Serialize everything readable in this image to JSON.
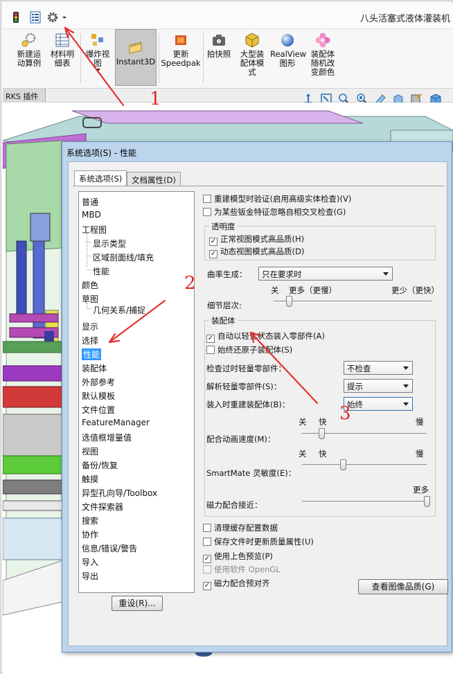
{
  "app": {
    "title": "八头活塞式液体灌装机"
  },
  "ribbon": {
    "buttons": [
      {
        "id": "new-motion",
        "label": "新建运\n动算例"
      },
      {
        "id": "bom",
        "label": "材料明\n细表"
      },
      {
        "id": "exploded",
        "label": "爆炸视\n图"
      },
      {
        "id": "instant3d",
        "label": "Instant3D"
      },
      {
        "id": "speedpak",
        "label": "更新\nSpeedpak"
      },
      {
        "id": "snapshot",
        "label": "拍快照"
      },
      {
        "id": "large-assembly",
        "label": "大型装\n配体模\n式"
      },
      {
        "id": "realview",
        "label": "RealView\n图形"
      },
      {
        "id": "random-color",
        "label": "装配体\n随机改\n变颜色"
      }
    ]
  },
  "tabbar": {
    "plugin_tab": "RKS 插件"
  },
  "dialog": {
    "title": "系统选项(S) - 性能",
    "tabs": [
      "系统选项(S)",
      "文档属性(D)"
    ],
    "nav": [
      "普通",
      "MBD",
      "工程图",
      "显示类型",
      "区域剖面线/填充",
      "性能",
      "颜色",
      "草图",
      "几何关系/捕捉",
      "显示",
      "选择",
      "性能",
      "装配体",
      "外部参考",
      "默认模板",
      "文件位置",
      "FeatureManager",
      "选值框增量值",
      "视图",
      "备份/恢复",
      "触摸",
      "异型孔向导/Toolbox",
      "文件探索器",
      "搜索",
      "协作",
      "信息/错误/警告",
      "导入",
      "导出"
    ],
    "reset_button": "重设(R)...",
    "options": {
      "rebuild_verify": "重建模型时验证(启用高级实体检查)(V)",
      "ignore_sheetmetal": "为某些钣金特征忽略自相交叉检查(G)"
    },
    "transparency": {
      "title": "透明度",
      "normal_view": "正常视图模式高品质(H)",
      "dynamic_view": "动态视图模式高品质(D)"
    },
    "curvature": {
      "label": "曲率生成：",
      "value": "只在要求时"
    },
    "detail": {
      "label": "细节层次:",
      "left": "关",
      "mid": "更多（更慢）",
      "right": "更少（更快）",
      "level": 0.1
    },
    "assembly": {
      "title": "装配体",
      "lightweight_load": "自动以轻化状态装入零部件(A)",
      "always_resolve": "始终还原子装配体(S)",
      "check_outdated_label": "检查过时轻量零部件：",
      "check_outdated_value": "不检查",
      "resolve_lightweight_label": "解析轻量零部件(S)：",
      "resolve_lightweight_value": "提示",
      "rebuild_on_load_label": "装入时重建装配体(B)：",
      "rebuild_on_load_value": "始终",
      "anim_off": "关",
      "anim_fast": "快",
      "anim_slow": "慢",
      "anim_label": "配合动画速度(M)：",
      "anim_level": 0.16,
      "smart_off": "关",
      "smart_fast": "快",
      "smart_slow": "慢",
      "smart_label": "SmartMate 灵敏度(E)：",
      "smart_level": 0.33,
      "mag_more": "更多",
      "mag_label": "磁力配合接近：",
      "mag_level": 1.0
    },
    "bottom_options": {
      "purge_cache": "清理缓存配置数据",
      "update_mass": "保存文件时更新质量属性(U)",
      "shaded_preview": "使用上色预览(P)",
      "software_opengl": "使用软件 OpenGL",
      "magnetic_prealign": "磁力配合预对齐"
    },
    "image_quality_button": "查看图像品质(G)"
  },
  "annotations": {
    "n1": "1",
    "n2": "2",
    "n3": "3"
  }
}
